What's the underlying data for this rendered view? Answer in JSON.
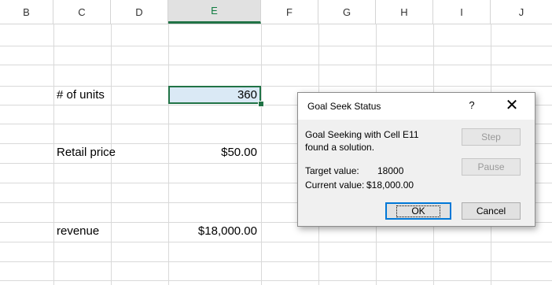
{
  "columns": [
    "B",
    "C",
    "D",
    "E",
    "F",
    "G",
    "H",
    "I",
    "J"
  ],
  "selected_column": "E",
  "cells": {
    "units_label": "# of units",
    "units_value": "360",
    "price_label": "Retail price",
    "price_value": "$50.00",
    "revenue_label": "revenue",
    "revenue_value": "$18,000.00"
  },
  "dialog": {
    "title": "Goal Seek Status",
    "help_label": "?",
    "close_label": "✕",
    "message_line1": "Goal Seeking with Cell E11",
    "message_line2": "found a solution.",
    "target_label": "Target value:",
    "target_value": "18000",
    "current_label": "Current value:",
    "current_value": "$18,000.00",
    "step_label": "Step",
    "pause_label": "Pause",
    "ok_label": "OK",
    "cancel_label": "Cancel"
  },
  "colors": {
    "accent": "#217346",
    "active_cell_fill": "#dae9f5",
    "dialog_bg": "#f0f0f0",
    "ok_border": "#0078d7"
  }
}
